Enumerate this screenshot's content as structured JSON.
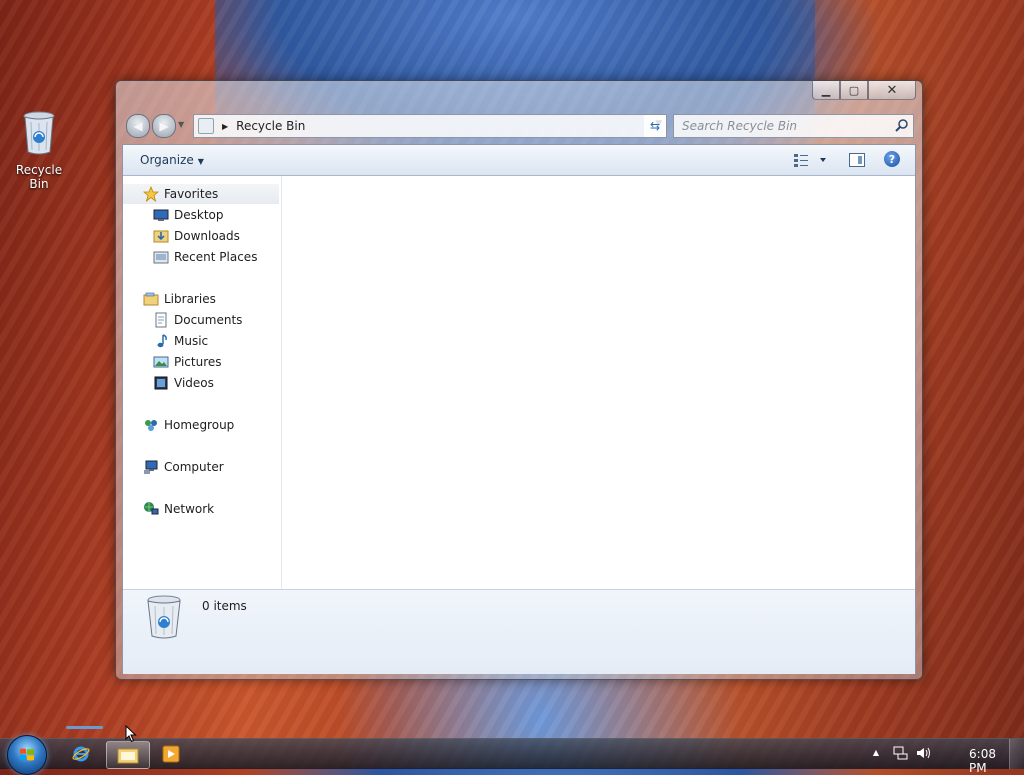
{
  "desktop": {
    "recycle_bin_label": "Recycle Bin"
  },
  "window": {
    "address": {
      "location": "Recycle Bin"
    },
    "search": {
      "placeholder": "Search Recycle Bin"
    },
    "toolbar": {
      "organize_label": "Organize"
    },
    "nav_pane": {
      "favorites": {
        "label": "Favorites",
        "items": [
          "Desktop",
          "Downloads",
          "Recent Places"
        ]
      },
      "libraries": {
        "label": "Libraries",
        "items": [
          "Documents",
          "Music",
          "Pictures",
          "Videos"
        ]
      },
      "homegroup": "Homegroup",
      "computer": "Computer",
      "network": "Network"
    },
    "details": {
      "item_count": "0 items"
    }
  },
  "taskbar": {
    "clock": "6:08 PM"
  },
  "colors": {
    "accent": "#1e395b",
    "help_blue": "#1b4fa4"
  }
}
